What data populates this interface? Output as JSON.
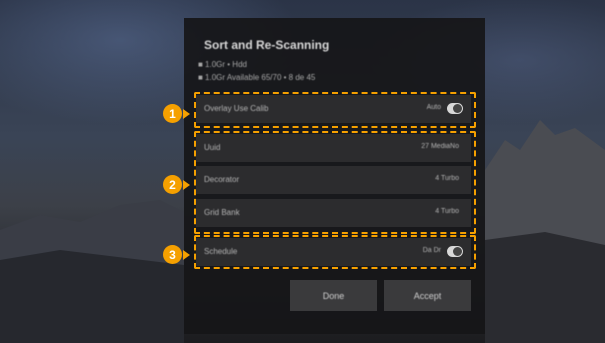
{
  "dialog": {
    "title": "Sort and Re-Scanning",
    "subtitle_line1": "■ 1.0Gr • Hdd",
    "subtitle_line2": "■ 1.0Gr Available 65/70 • 8 de 45",
    "rows": [
      {
        "label": "Overlay Use Calib",
        "value": "Auto"
      },
      {
        "label": "Uuid",
        "value": "27 MediaNo"
      },
      {
        "label": "Decorator",
        "value": "4 Turbo"
      },
      {
        "label": "Grid Bank",
        "value": "4 Turbo"
      },
      {
        "label": "Schedule",
        "value": "Da Dr"
      }
    ],
    "buttons": {
      "cancel": "Done",
      "accept": "Accept"
    }
  },
  "callouts": [
    "1",
    "2",
    "3"
  ],
  "colors": {
    "highlight": "#f5a000",
    "dialog_bg": "#161618",
    "row_bg": "#2c2c2e"
  }
}
